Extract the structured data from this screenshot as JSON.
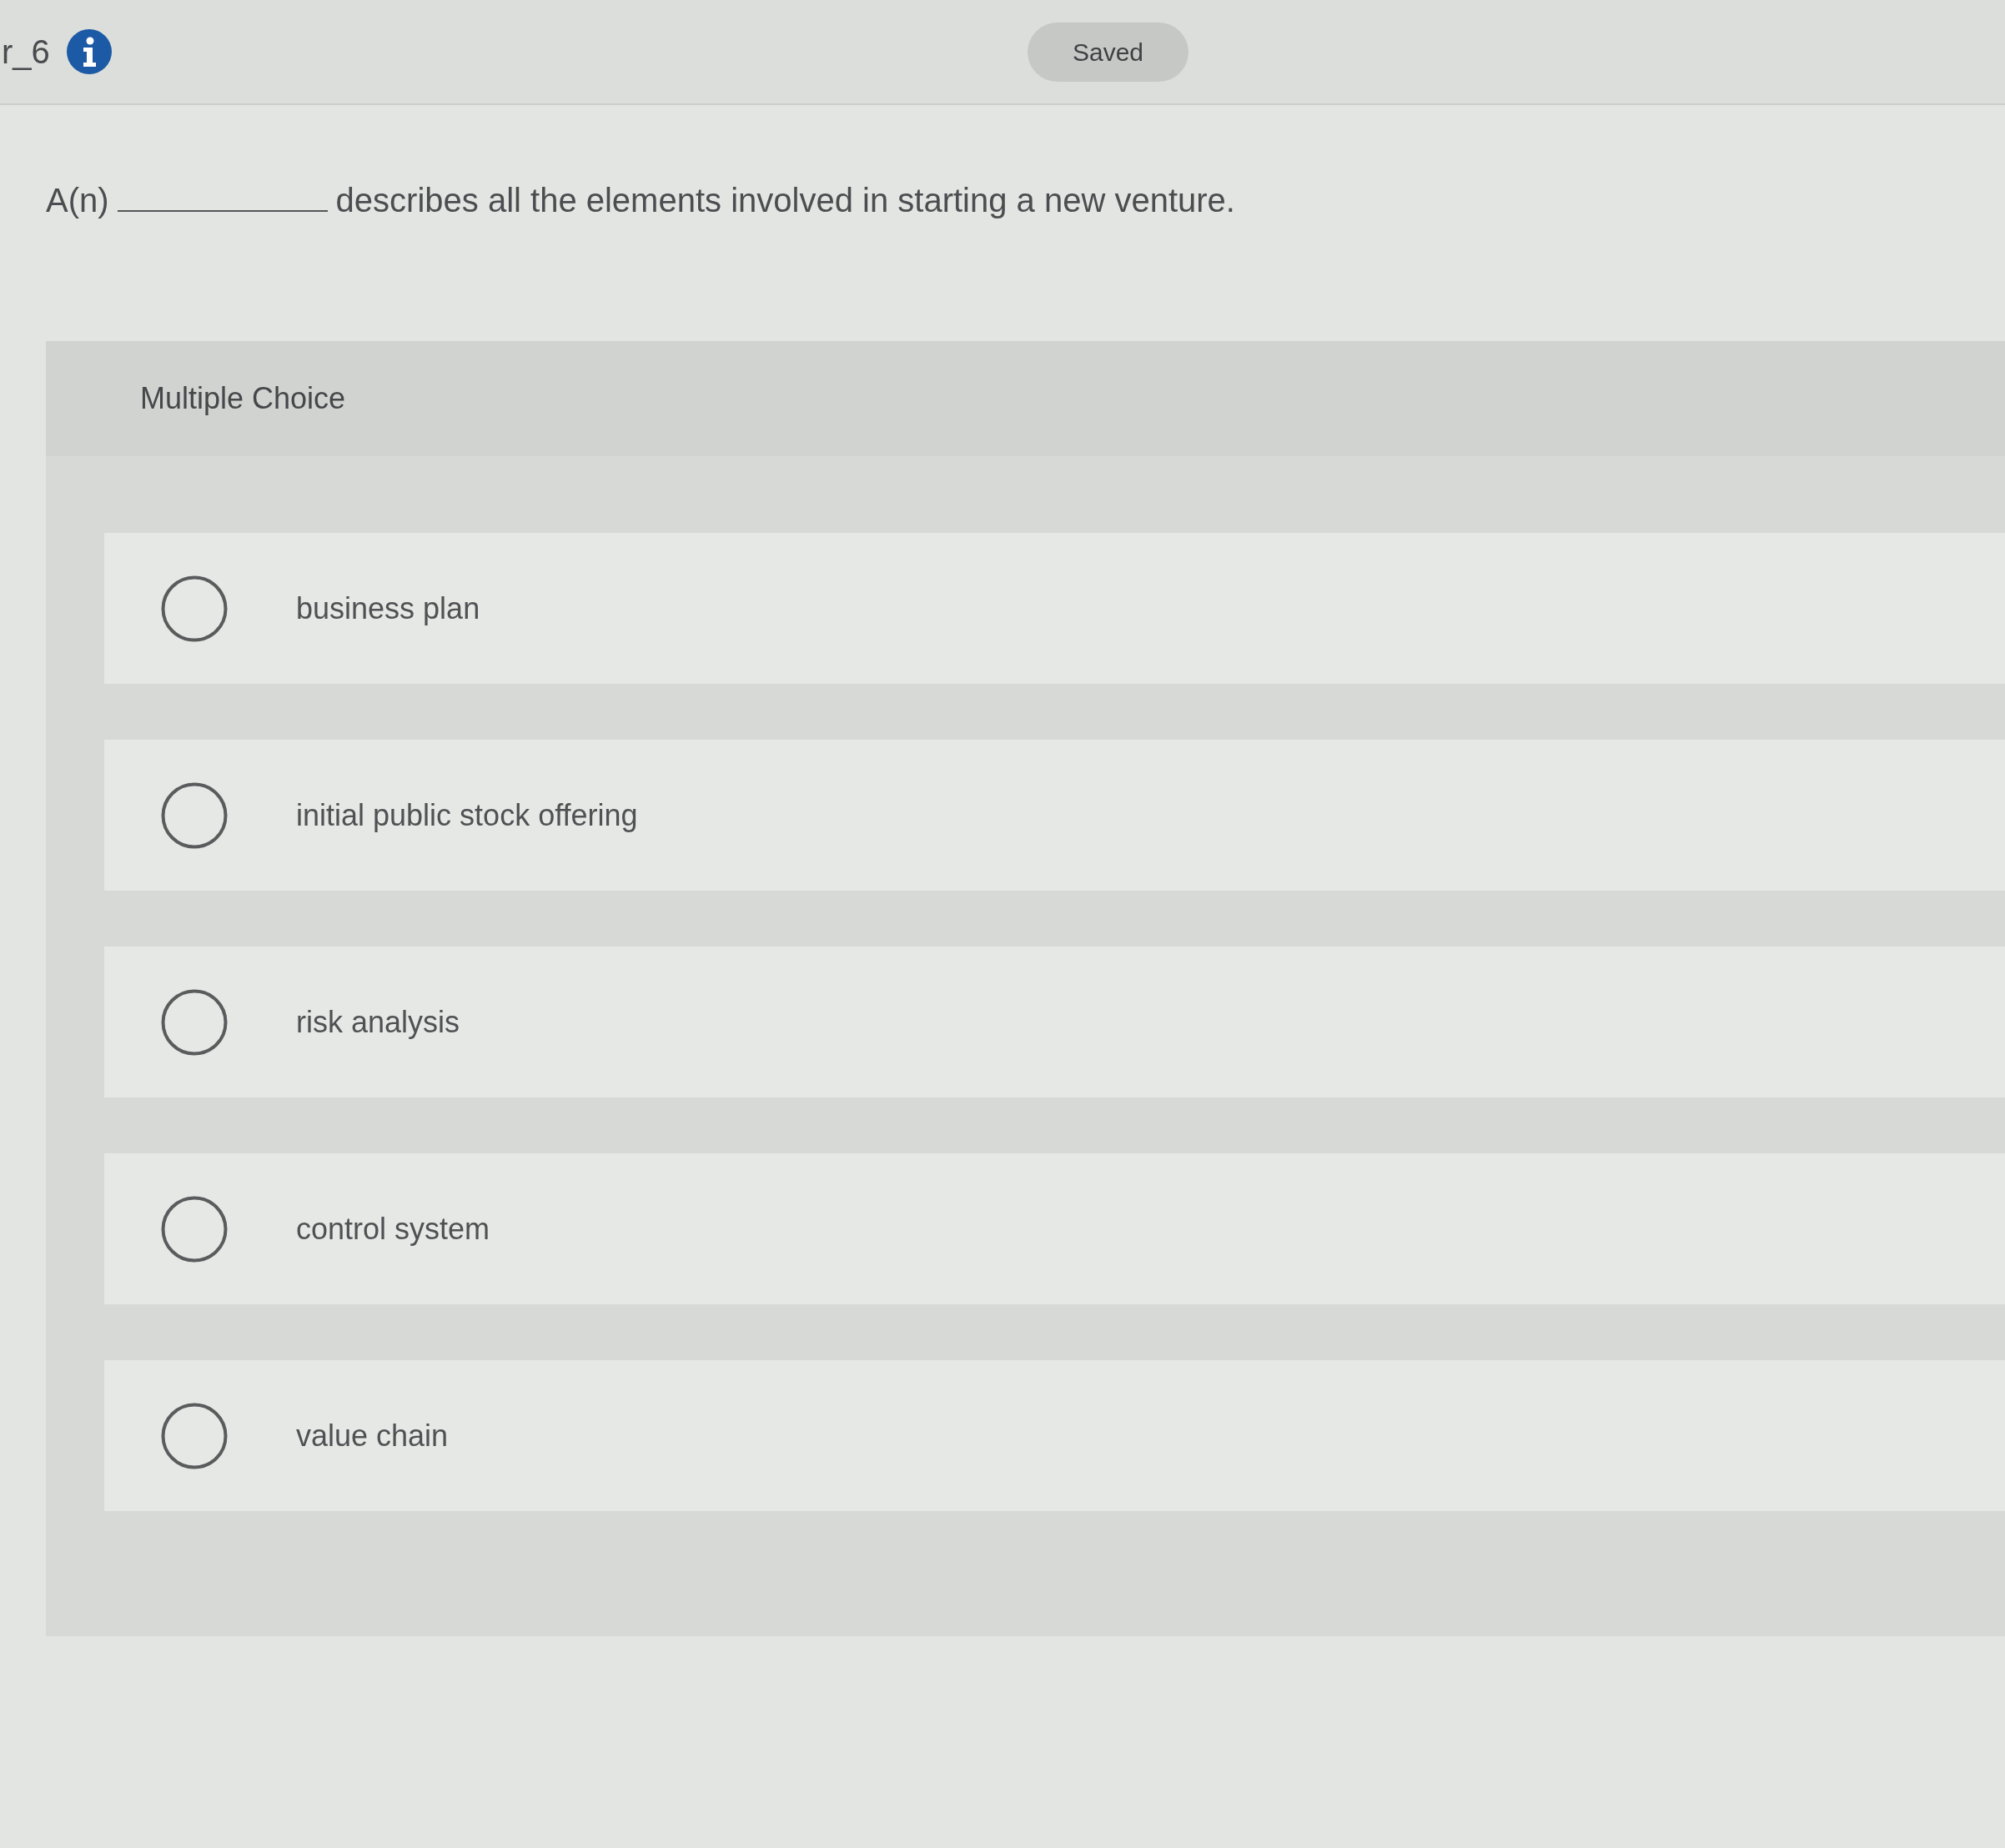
{
  "header": {
    "title": "r_6",
    "status": "Saved"
  },
  "question": {
    "prefix": "A(n)",
    "text": "describes all the elements involved in starting a new venture."
  },
  "answer_area": {
    "type_label": "Multiple Choice",
    "options": [
      {
        "label": "business plan",
        "selected": false
      },
      {
        "label": "initial public stock offering",
        "selected": false
      },
      {
        "label": "risk analysis",
        "selected": false
      },
      {
        "label": "control system",
        "selected": false
      },
      {
        "label": "value chain",
        "selected": false
      }
    ]
  }
}
